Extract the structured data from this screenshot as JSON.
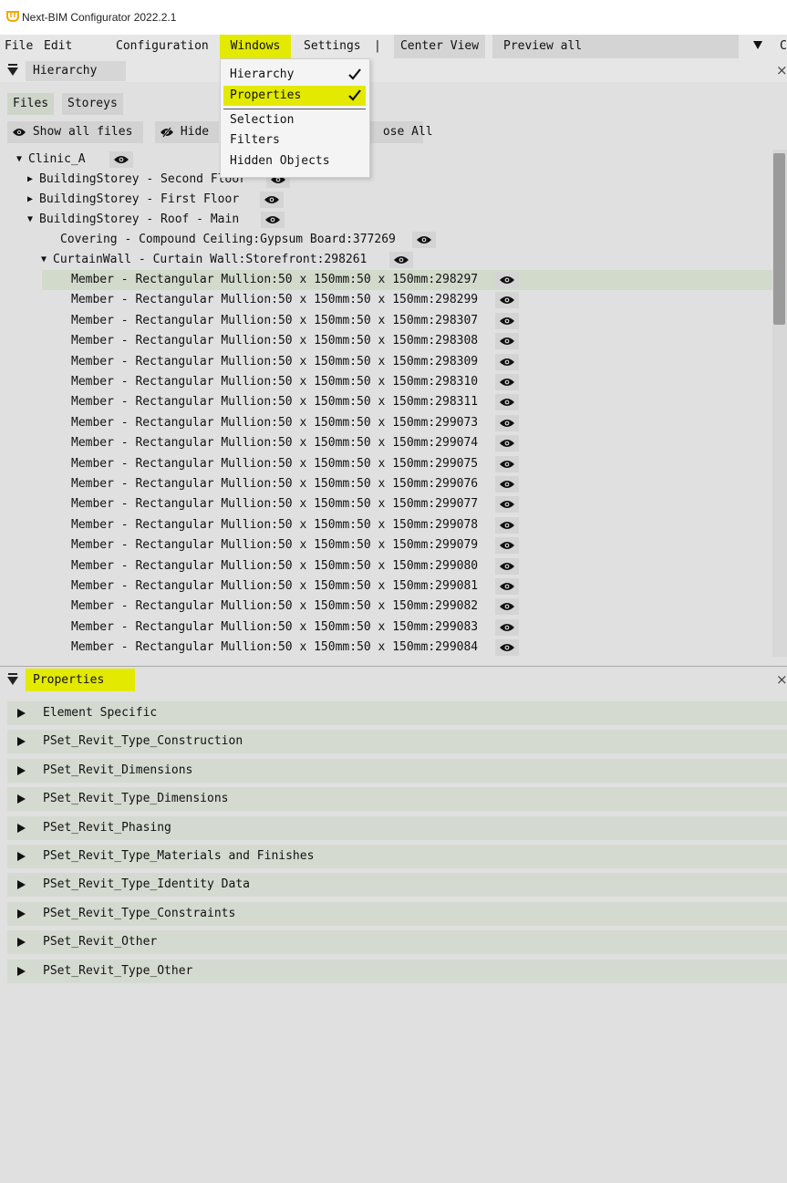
{
  "window": {
    "title": "Next-BIM Configurator 2022.2.1"
  },
  "menu": {
    "file": "File",
    "edit": "Edit",
    "configuration": "Configuration",
    "windows": "Windows",
    "settings": "Settings",
    "separator": "|",
    "center_view": "Center View",
    "preview_all": "Preview all",
    "overflow": "C"
  },
  "windows_menu": {
    "items": [
      {
        "label": "Hierarchy",
        "checked": true
      },
      {
        "label": "Properties",
        "checked": true,
        "highlighted": true
      },
      {
        "label": "Selection",
        "checked": false
      },
      {
        "label": "Filters",
        "checked": false
      },
      {
        "label": "Hidden Objects",
        "checked": false
      }
    ]
  },
  "hierarchy": {
    "title": "Hierarchy",
    "close": "×",
    "tabs": {
      "files": "Files",
      "storeys": "Storeys"
    },
    "toolbar": {
      "show_all": "Show all files",
      "hide": "Hide",
      "collapse_all_partial": "ose All"
    },
    "tree": {
      "root": "Clinic_A",
      "storey_second": "BuildingStorey - Second Floor",
      "storey_first": "BuildingStorey - First Floor",
      "storey_roof": "BuildingStorey - Roof - Main",
      "covering": "Covering - Compound Ceiling:Gypsum Board:377269",
      "curtain_wall": "CurtainWall - Curtain Wall:Storefront:298261",
      "members": [
        "Member - Rectangular Mullion:50 x 150mm:50 x 150mm:298297",
        "Member - Rectangular Mullion:50 x 150mm:50 x 150mm:298299",
        "Member - Rectangular Mullion:50 x 150mm:50 x 150mm:298307",
        "Member - Rectangular Mullion:50 x 150mm:50 x 150mm:298308",
        "Member - Rectangular Mullion:50 x 150mm:50 x 150mm:298309",
        "Member - Rectangular Mullion:50 x 150mm:50 x 150mm:298310",
        "Member - Rectangular Mullion:50 x 150mm:50 x 150mm:298311",
        "Member - Rectangular Mullion:50 x 150mm:50 x 150mm:299073",
        "Member - Rectangular Mullion:50 x 150mm:50 x 150mm:299074",
        "Member - Rectangular Mullion:50 x 150mm:50 x 150mm:299075",
        "Member - Rectangular Mullion:50 x 150mm:50 x 150mm:299076",
        "Member - Rectangular Mullion:50 x 150mm:50 x 150mm:299077",
        "Member - Rectangular Mullion:50 x 150mm:50 x 150mm:299078",
        "Member - Rectangular Mullion:50 x 150mm:50 x 150mm:299079",
        "Member - Rectangular Mullion:50 x 150mm:50 x 150mm:299080",
        "Member - Rectangular Mullion:50 x 150mm:50 x 150mm:299081",
        "Member - Rectangular Mullion:50 x 150mm:50 x 150mm:299082",
        "Member - Rectangular Mullion:50 x 150mm:50 x 150mm:299083",
        "Member - Rectangular Mullion:50 x 150mm:50 x 150mm:299084"
      ]
    }
  },
  "properties": {
    "title": "Properties",
    "close": "×",
    "sections": [
      "Element Specific",
      "PSet_Revit_Type_Construction",
      "PSet_Revit_Dimensions",
      "PSet_Revit_Type_Dimensions",
      "PSet_Revit_Phasing",
      "PSet_Revit_Type_Materials and Finishes",
      "PSet_Revit_Type_Identity Data",
      "PSet_Revit_Type_Constraints",
      "PSet_Revit_Other",
      "PSet_Revit_Type_Other"
    ]
  },
  "colors": {
    "accent_highlight": "#e3ea00",
    "selected_row": "#d2dacc",
    "section_row": "#d4dad0",
    "background": "#e0e0e0"
  },
  "icons": [
    "app-logo-icon",
    "eye-icon",
    "eye-slash-icon",
    "folder-icon",
    "check-icon",
    "collapse-icon",
    "close-icon",
    "expand-arrow-icon",
    "dropdown-triangle-icon"
  ]
}
